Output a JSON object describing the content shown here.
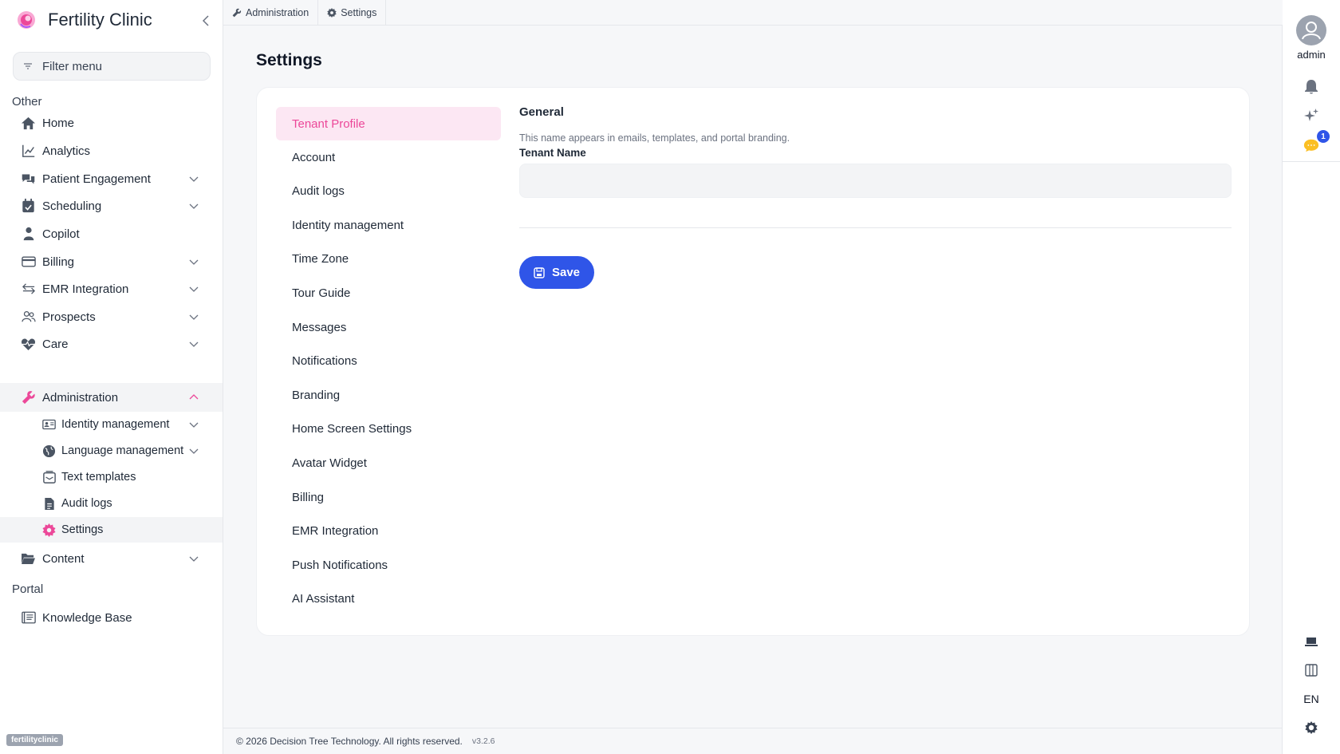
{
  "app": {
    "name": "Fertility Clinic",
    "tenant_tag": "fertilityclinic"
  },
  "sidebar": {
    "filter_placeholder": "Filter menu",
    "sections": {
      "other": "Other",
      "portal": "Portal"
    },
    "items": [
      {
        "label": "Home"
      },
      {
        "label": "Analytics"
      },
      {
        "label": "Patient Engagement"
      },
      {
        "label": "Scheduling"
      },
      {
        "label": "Copilot"
      },
      {
        "label": "Billing"
      },
      {
        "label": "EMR Integration"
      },
      {
        "label": "Prospects"
      },
      {
        "label": "Care"
      },
      {
        "label": "Administration"
      },
      {
        "label": "Content"
      },
      {
        "label": "Knowledge Base"
      }
    ],
    "admin_sub": [
      {
        "label": "Identity management"
      },
      {
        "label": "Language management"
      },
      {
        "label": "Text templates"
      },
      {
        "label": "Audit logs"
      },
      {
        "label": "Settings"
      }
    ]
  },
  "breadcrumb": {
    "first": "Administration",
    "second": "Settings"
  },
  "page": {
    "title": "Settings"
  },
  "tabs": [
    "Tenant Profile",
    "Account",
    "Audit logs",
    "Identity management",
    "Time Zone",
    "Tour Guide",
    "Messages",
    "Notifications",
    "Branding",
    "Home Screen Settings",
    "Avatar Widget",
    "Billing",
    "EMR Integration",
    "Push Notifications",
    "AI Assistant"
  ],
  "active_tab": "Tenant Profile",
  "form": {
    "section_title": "General",
    "hint": "This name appears in emails, templates, and portal branding.",
    "field_label": "Tenant Name",
    "field_value": "",
    "save_label": "Save"
  },
  "footer": {
    "copyright": "© 2026 Decision Tree Technology. All rights reserved.",
    "version": "v3.2.6"
  },
  "rail": {
    "username": "admin",
    "notification_count": "1",
    "language": "EN"
  },
  "colors": {
    "accent_pink": "#ec4899",
    "primary_blue": "#2f55e8"
  }
}
